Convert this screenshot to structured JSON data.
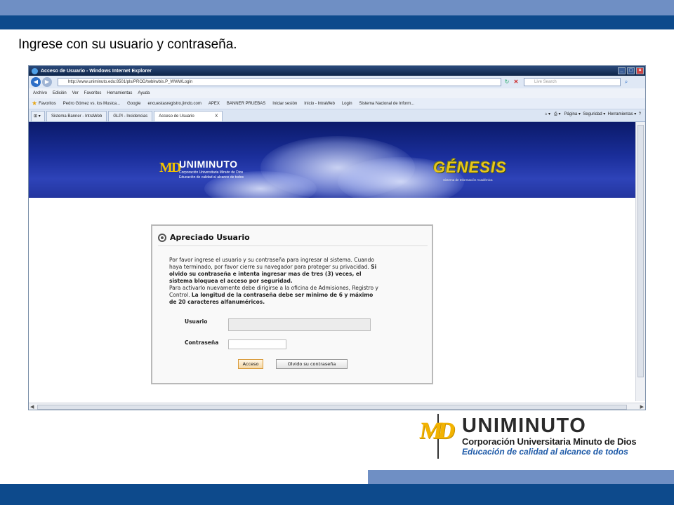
{
  "slide": {
    "title": "Ingrese con su usuario y contraseña.",
    "colors": {
      "band_dark": "#0d4a8c",
      "band_light": "#6f8fc4",
      "logo_yellow": "#f3b300",
      "logo_blue": "#1e5aa8"
    }
  },
  "browser": {
    "window_title": "Acceso de Usuario - Windows Internet Explorer",
    "address": "http://www.uniminuto.edu:8501/pls/PROD/twbkwbis.P_WWWLogin",
    "search_placeholder": "Live Search",
    "menu": [
      "Archivo",
      "Edición",
      "Ver",
      "Favoritos",
      "Herramientas",
      "Ayuda"
    ],
    "favorites_label": "Favoritos",
    "favorites": [
      "Pedro Gómez vs. los Musica...",
      "Google",
      "encuestasregistro.jimdo.com",
      "APEX",
      "BANNER PRUEBAS",
      "Iniciar sesión",
      "Inicio - IntraWeb",
      "Login",
      "Sistema Nacional de Inform..."
    ],
    "tabs": [
      "Sistema Banner - IntraWeb",
      "GLPI - Incidencias",
      "Acceso de Usuario"
    ],
    "tab_close": "X",
    "command_bar": [
      "Página",
      "Seguridad",
      "Herramientas"
    ]
  },
  "page": {
    "banner": {
      "logo_initials": "MD",
      "logo_name": "UNIMINUTO",
      "logo_line1": "Corporación Universitaria Minuto de Dios",
      "logo_line2": "Educación de calidad al alcance de todos",
      "system_name": "GÉNESIS",
      "system_subtitle": "Sistema de Información Académica"
    },
    "login": {
      "title": "Apreciado Usuario",
      "text_p1": "Por favor ingrese el usuario y su contraseña para ingresar al sistema. Cuando haya terminado, por favor cierre su navegador para proteger su privacidad. ",
      "text_b1": "Si olvido su contraseña e intenta ingresar mas de tres (3) veces, el sistema bloquea el acceso por seguridad.",
      "text_p2": "Para activarlo nuevamente debe dirigirse a la oficina de Admisiones, Registro y Control. ",
      "text_b2": "La longitud de la contraseña debe ser minimo de 6 y máximo de 20 caracteres alfanuméricos.",
      "user_label": "Usuario",
      "user_value": "",
      "password_label": "Contraseña",
      "password_value": "",
      "login_button": "Acceso",
      "forgot_button": "Olvido su contraseña"
    }
  },
  "footer_logo": {
    "initials": "MD",
    "name": "UNIMINUTO",
    "line1": "Corporación Universitaria Minuto de Dios",
    "line2": "Educación de calidad al alcance de todos"
  }
}
